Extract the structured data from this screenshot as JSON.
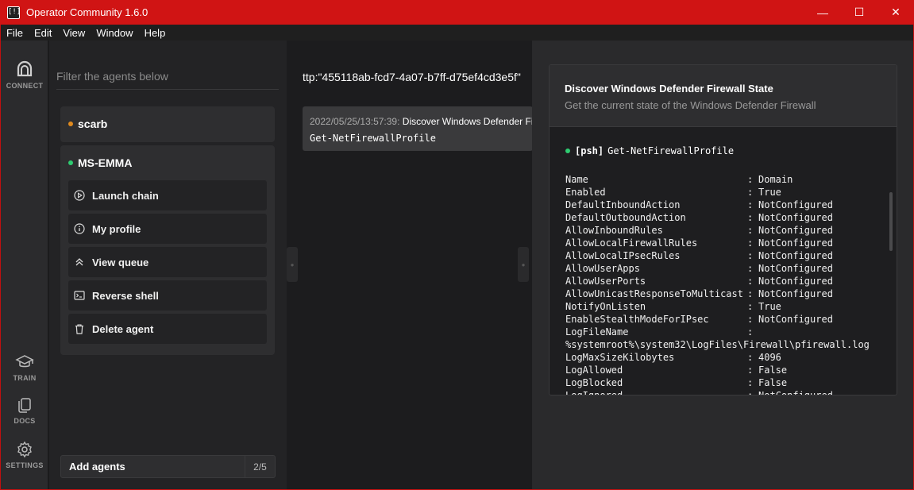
{
  "window": {
    "title": "Operator Community 1.6.0",
    "icon_text": "[!]",
    "minimize": "—",
    "maximize": "☐",
    "close": "✕"
  },
  "menu": [
    "File",
    "Edit",
    "View",
    "Window",
    "Help"
  ],
  "rail": {
    "connect": "CONNECT",
    "train": "TRAIN",
    "docs": "DOCS",
    "settings": "SETTINGS"
  },
  "agents": {
    "filter_placeholder": "Filter the agents below",
    "list": [
      {
        "name": "scarb",
        "status_color": "#e08a1e"
      },
      {
        "name": "MS-EMMA",
        "status_color": "#2ecc71"
      }
    ],
    "actions": [
      {
        "label": "Launch chain",
        "icon": "play-circle-icon"
      },
      {
        "label": "My profile",
        "icon": "info-circle-icon"
      },
      {
        "label": "View queue",
        "icon": "chevrons-up-icon"
      },
      {
        "label": "Reverse shell",
        "icon": "terminal-icon"
      },
      {
        "label": "Delete agent",
        "icon": "trash-icon"
      }
    ],
    "add_label": "Add agents",
    "add_count": "2/5"
  },
  "middle": {
    "query": "ttp:\"455118ab-fcd7-4a07-b7ff-d75ef4cd3e5f\"",
    "link": {
      "timestamp": "2022/05/25/13:57:39:",
      "name": "Discover Windows Defender Firewall State",
      "command": "Get-NetFirewallProfile"
    }
  },
  "detail": {
    "title": "Discover Windows Defender Firewall State",
    "subtitle": "Get the current state of the Windows Defender Firewall",
    "executor": "[psh]",
    "command": "Get-NetFirewallProfile",
    "output": [
      {
        "key": "Name",
        "value": "Domain"
      },
      {
        "key": "Enabled",
        "value": "True"
      },
      {
        "key": "DefaultInboundAction",
        "value": "NotConfigured"
      },
      {
        "key": "DefaultOutboundAction",
        "value": "NotConfigured"
      },
      {
        "key": "AllowInboundRules",
        "value": "NotConfigured"
      },
      {
        "key": "AllowLocalFirewallRules",
        "value": "NotConfigured"
      },
      {
        "key": "AllowLocalIPsecRules",
        "value": "NotConfigured"
      },
      {
        "key": "AllowUserApps",
        "value": "NotConfigured"
      },
      {
        "key": "AllowUserPorts",
        "value": "NotConfigured"
      },
      {
        "key": "AllowUnicastResponseToMulticast",
        "value": "NotConfigured"
      },
      {
        "key": "NotifyOnListen",
        "value": "True"
      },
      {
        "key": "EnableStealthModeForIPsec",
        "value": "NotConfigured"
      },
      {
        "key": "LogFileName",
        "value": ""
      },
      {
        "full": "%systemroot%\\system32\\LogFiles\\Firewall\\pfirewall.log"
      },
      {
        "key": "LogMaxSizeKilobytes",
        "value": "4096"
      },
      {
        "key": "LogAllowed",
        "value": "False"
      },
      {
        "key": "LogBlocked",
        "value": "False"
      },
      {
        "key": "LogIgnored",
        "value": "NotConfigured"
      }
    ]
  }
}
